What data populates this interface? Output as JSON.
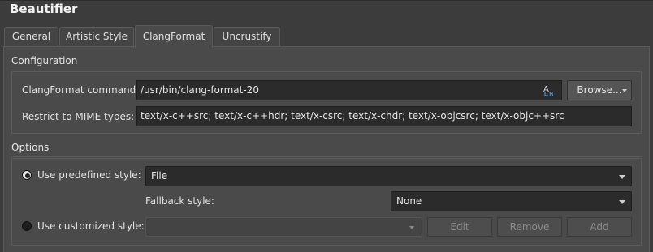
{
  "window": {
    "title": "Beautifier"
  },
  "tabs": [
    {
      "label": "General",
      "active": false
    },
    {
      "label": "Artistic Style",
      "active": false
    },
    {
      "label": "ClangFormat",
      "active": true
    },
    {
      "label": "Uncrustify",
      "active": false
    }
  ],
  "configuration": {
    "title": "Configuration",
    "command_label": "ClangFormat command:",
    "command_value": "/usr/bin/clang-format-20",
    "command_icon": "path-chooser-icon",
    "browse_label": "Browse...",
    "mime_label": "Restrict to MIME types:",
    "mime_value": "text/x-c++src; text/x-c++hdr; text/x-csrc; text/x-chdr; text/x-objcsrc; text/x-objc++src"
  },
  "options": {
    "title": "Options",
    "predefined_label": "Use predefined style:",
    "predefined_selected": true,
    "predefined_value": "File",
    "fallback_label": "Fallback style:",
    "fallback_value": "None",
    "customized_label": "Use customized style:",
    "customized_selected": false,
    "customized_value": "",
    "edit_label": "Edit",
    "remove_label": "Remove",
    "add_label": "Add"
  }
}
